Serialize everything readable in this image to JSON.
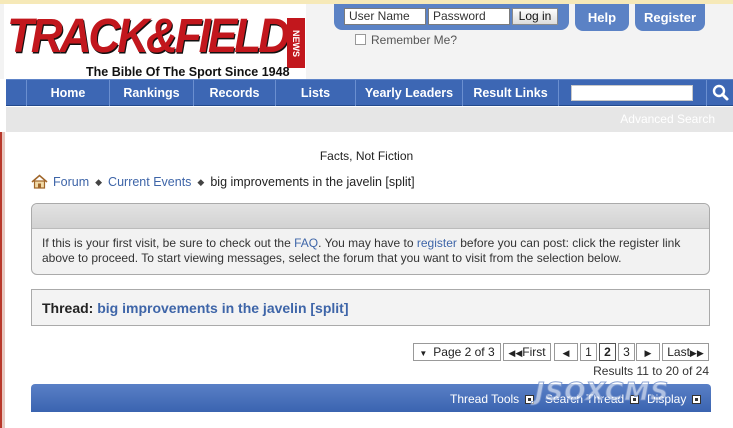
{
  "brand": {
    "logo_text": "TRACK&FIELD",
    "logo_news": "NEWS",
    "tagline": "The Bible Of The Sport Since 1948"
  },
  "login": {
    "username_value": "User Name",
    "password_value": "Password",
    "login_label": "Log in",
    "remember_label": "Remember Me?"
  },
  "top_links": {
    "help": "Help",
    "register": "Register"
  },
  "nav": {
    "items": [
      "Home",
      "Rankings",
      "Records",
      "Lists",
      "Yearly Leaders",
      "Result Links"
    ],
    "search_value": "",
    "advanced_search": "Advanced Search"
  },
  "page": {
    "motto": "Facts, Not Fiction"
  },
  "breadcrumb": {
    "forum": "Forum",
    "current_events": "Current Events",
    "current": "big improvements in the javelin [split]"
  },
  "notice": {
    "text_1": "If this is your first visit, be sure to check out the ",
    "faq": "FAQ",
    "text_2": ". You may have to ",
    "register": "register",
    "text_3": " before you can post: click the register link above to proceed. To start viewing messages, select the forum that you want to visit from the selection below."
  },
  "thread": {
    "label": "Thread:",
    "title": "big improvements in the javelin [split]"
  },
  "pagination": {
    "page_of": "Page 2 of 3",
    "first": "First",
    "pages": [
      "1",
      "2",
      "3"
    ],
    "current_page": "2",
    "last": "Last",
    "results": "Results 11 to 20 of 24"
  },
  "tools": {
    "thread_tools": "Thread Tools",
    "search_thread": "Search Thread",
    "display": "Display"
  },
  "watermark": "JSOXCMS",
  "colors": {
    "nav_blue": "#3d67b4",
    "link_blue": "#3e65a8",
    "logo_red": "#c2171d"
  }
}
